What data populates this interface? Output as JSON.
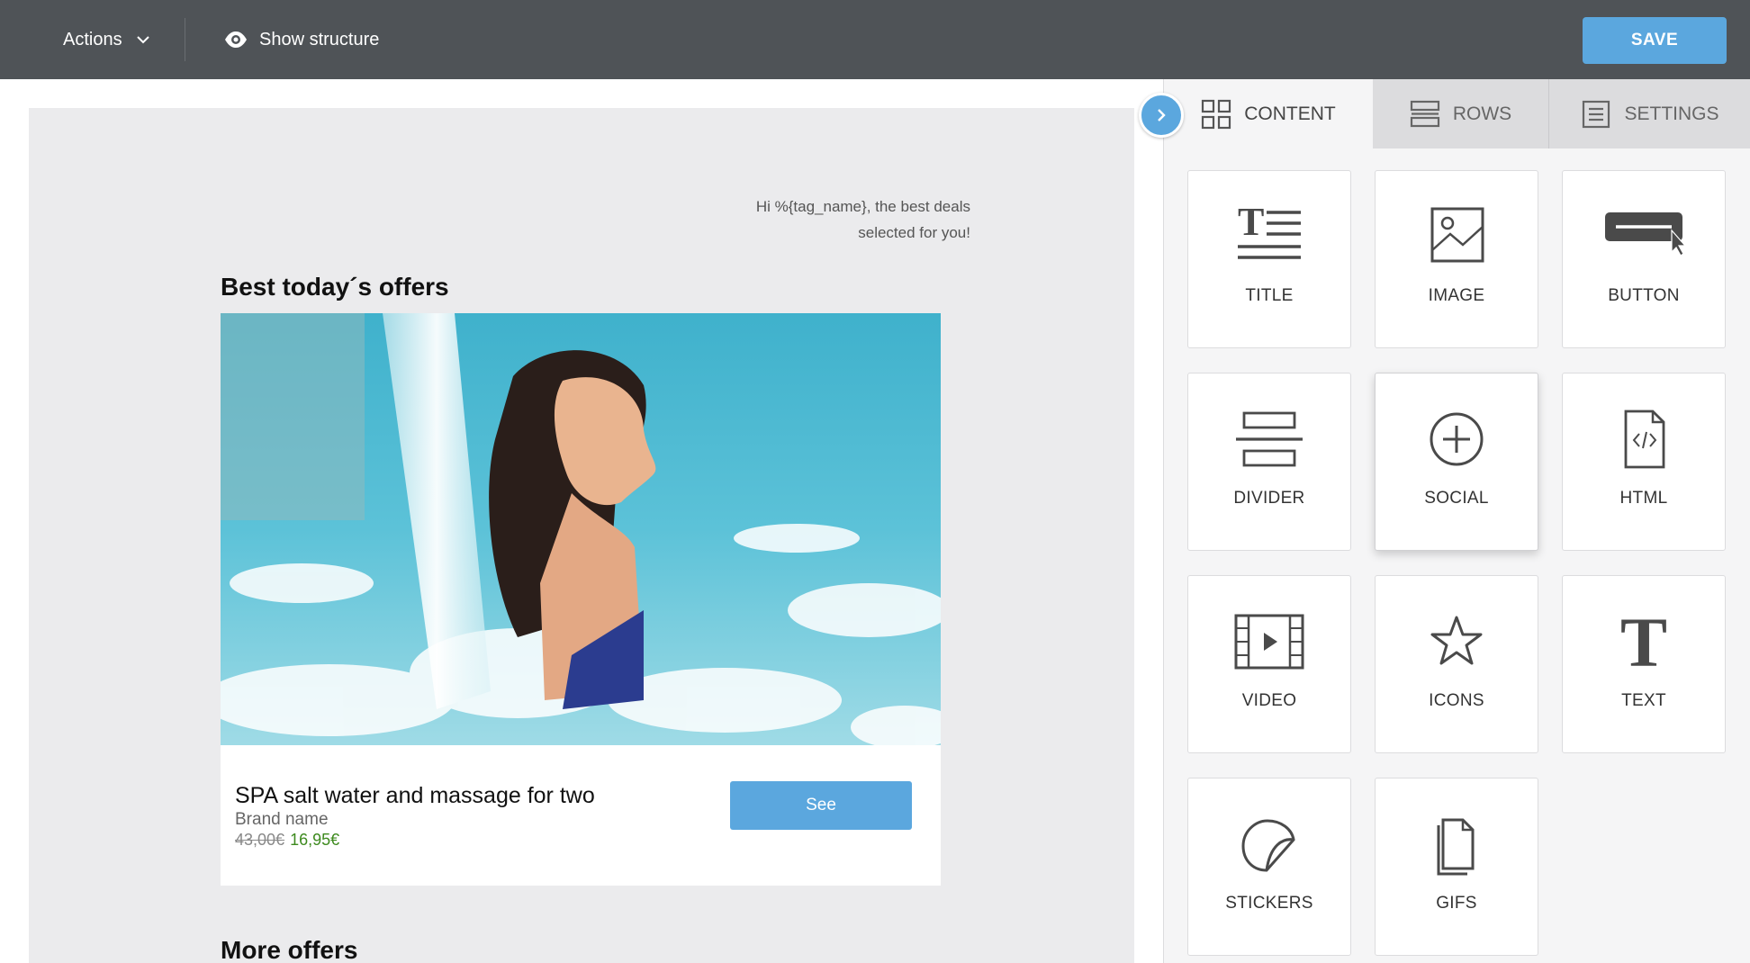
{
  "topbar": {
    "actions_label": "Actions",
    "show_structure_label": "Show structure",
    "save_label": "SAVE"
  },
  "email": {
    "greeting_line1": "Hi %{tag_name}, the best deals",
    "greeting_line2": "selected for you!",
    "section_title": "Best today´s offers",
    "product": {
      "name": "SPA salt water and massage for two",
      "brand": "Brand name",
      "old_price": "43,00€",
      "new_price": "16,95€",
      "button_label": "See"
    },
    "more_offers_title": "More offers"
  },
  "panel": {
    "tabs": [
      {
        "label": "CONTENT",
        "icon": "grid-icon",
        "active": true
      },
      {
        "label": "ROWS",
        "icon": "rows-icon",
        "active": false
      },
      {
        "label": "SETTINGS",
        "icon": "settings-list-icon",
        "active": false
      }
    ],
    "tiles": [
      {
        "label": "TITLE",
        "icon": "title-icon"
      },
      {
        "label": "IMAGE",
        "icon": "image-icon"
      },
      {
        "label": "BUTTON",
        "icon": "button-icon"
      },
      {
        "label": "DIVIDER",
        "icon": "divider-icon"
      },
      {
        "label": "SOCIAL",
        "icon": "social-icon"
      },
      {
        "label": "HTML",
        "icon": "html-icon"
      },
      {
        "label": "VIDEO",
        "icon": "video-icon"
      },
      {
        "label": "ICONS",
        "icon": "star-icon"
      },
      {
        "label": "TEXT",
        "icon": "text-icon"
      },
      {
        "label": "STICKERS",
        "icon": "sticker-icon"
      },
      {
        "label": "GIFS",
        "icon": "gif-icon"
      }
    ]
  },
  "colors": {
    "topbar_bg": "#4f5357",
    "accent_blue": "#5ba7de",
    "price_green": "#3d8a1e",
    "email_bg": "#ebebed"
  }
}
